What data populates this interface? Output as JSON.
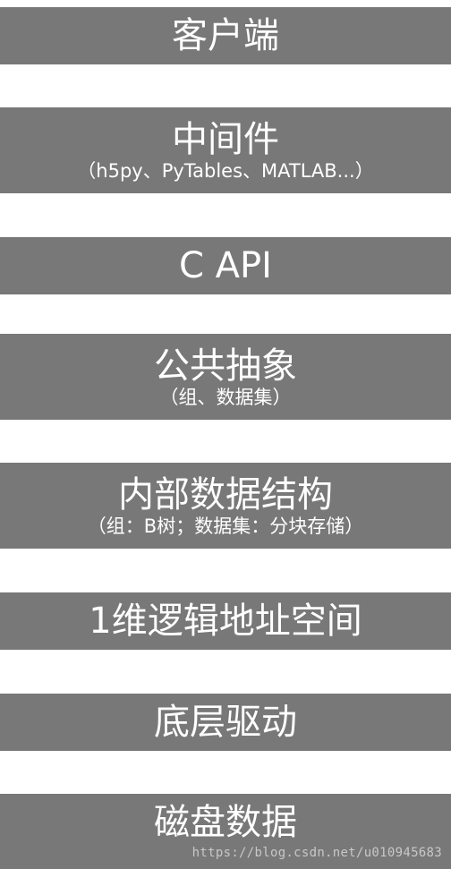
{
  "layers": [
    {
      "title": "客户端",
      "subtitle": ""
    },
    {
      "title": "中间件",
      "subtitle": "（h5py、PyTables、MATLAB...）"
    },
    {
      "title": "C API",
      "subtitle": ""
    },
    {
      "title": "公共抽象",
      "subtitle": "（组、数据集）"
    },
    {
      "title": "内部数据结构",
      "subtitle": "（组：B树；数据集：分块存储）"
    },
    {
      "title": "1维逻辑地址空间",
      "subtitle": ""
    },
    {
      "title": "底层驱动",
      "subtitle": ""
    },
    {
      "title": "磁盘数据",
      "subtitle": ""
    }
  ],
  "watermark": "https://blog.csdn.net/u010945683",
  "colors": {
    "block_fill": "#787878",
    "block_text": "#ffffff",
    "background": "#ffffff"
  }
}
